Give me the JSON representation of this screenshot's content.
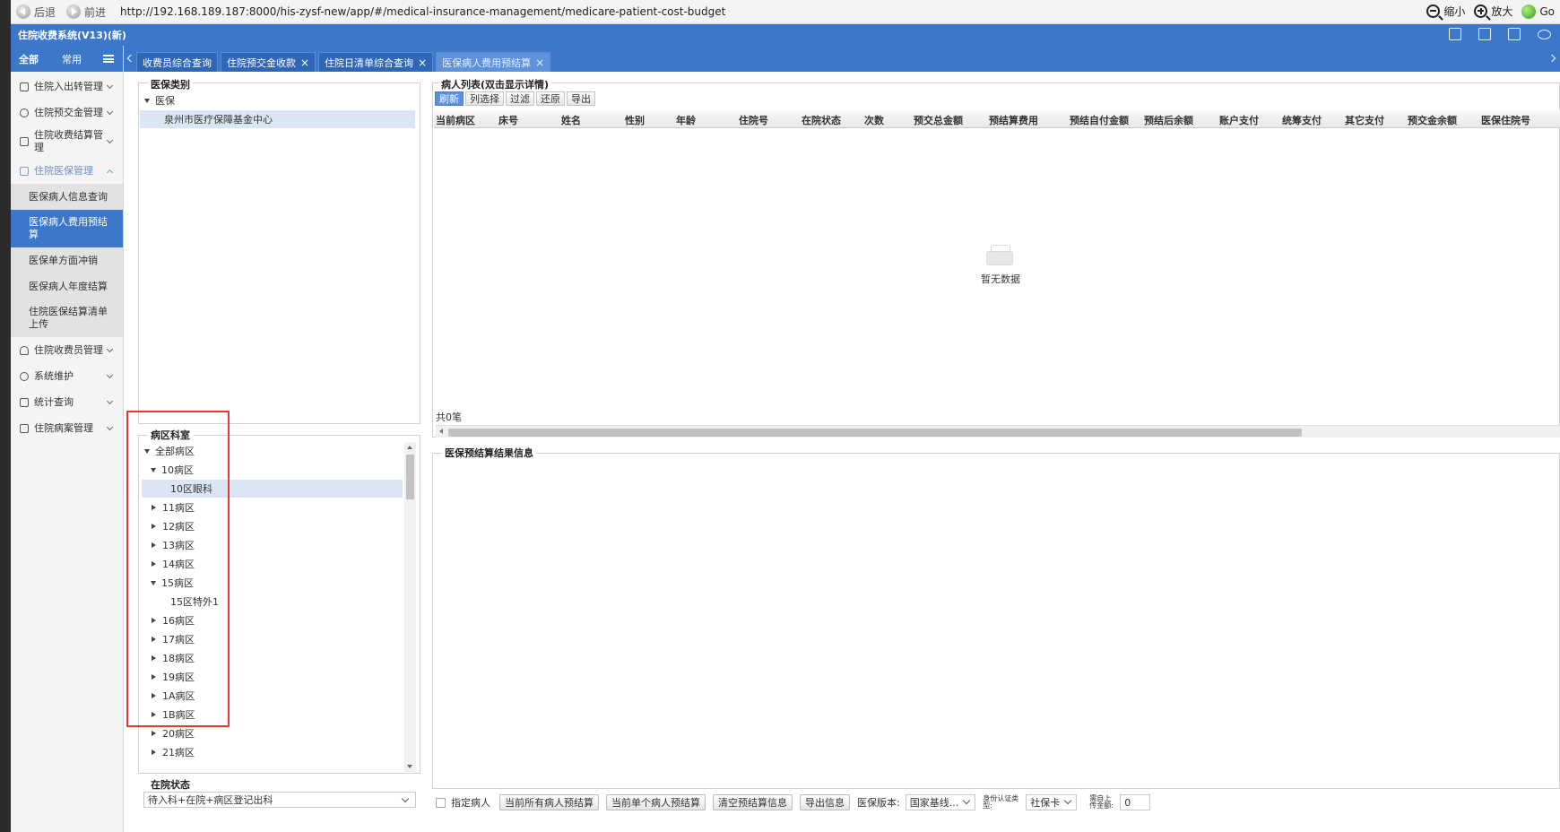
{
  "browser": {
    "back": "后退",
    "forward": "前进",
    "url": "http://192.168.189.187:8000/his-zysf-new/app/#/medical-insurance-management/medicare-patient-cost-budget",
    "zoom_out": "缩小",
    "zoom_in": "放大",
    "go": "Go"
  },
  "app": {
    "title": "住院收费系统(V13)(新)"
  },
  "sidebar": {
    "tabs": [
      "全部",
      "常用"
    ],
    "items": [
      {
        "label": "住院入出转管理"
      },
      {
        "label": "住院预交金管理"
      },
      {
        "label": "住院收费结算管理"
      },
      {
        "label": "住院医保管理"
      },
      {
        "label": "住院收费员管理"
      },
      {
        "label": "系统维护"
      },
      {
        "label": "统计查询"
      },
      {
        "label": "住院病案管理"
      }
    ],
    "subitems": [
      {
        "label": "医保病人信息查询"
      },
      {
        "label": "医保病人费用预结算"
      },
      {
        "label": "医保单方面冲销"
      },
      {
        "label": "医保病人年度结算"
      },
      {
        "label": "住院医保结算清单上传"
      }
    ]
  },
  "tabs": [
    {
      "label": "收费员综合查询"
    },
    {
      "label": "住院预交金收款"
    },
    {
      "label": "住院日清单综合查询"
    },
    {
      "label": "医保病人费用预结算"
    }
  ],
  "insurance_panel": {
    "title": "医保类别",
    "root": "医保",
    "child": "泉州市医疗保障基金中心"
  },
  "ward_panel": {
    "title": "病区科室",
    "root": "全部病区",
    "nodes": [
      {
        "label": "10病区"
      },
      {
        "label": "10区眼科"
      },
      {
        "label": "11病区"
      },
      {
        "label": "12病区"
      },
      {
        "label": "13病区"
      },
      {
        "label": "14病区"
      },
      {
        "label": "15病区"
      },
      {
        "label": "15区特外1"
      },
      {
        "label": "16病区"
      },
      {
        "label": "17病区"
      },
      {
        "label": "18病区"
      },
      {
        "label": "19病区"
      },
      {
        "label": "1A病区"
      },
      {
        "label": "1B病区"
      },
      {
        "label": "20病区"
      },
      {
        "label": "21病区"
      }
    ]
  },
  "status_panel": {
    "title": "在院状态",
    "selected": "待入科+在院+病区登记出科"
  },
  "patient_list": {
    "title": "病人列表(双击显示详情)",
    "toolbar": [
      "刷新",
      "列选择",
      "过滤",
      "还原",
      "导出"
    ],
    "columns": [
      "当前病区",
      "床号",
      "姓名",
      "性别",
      "年龄",
      "住院号",
      "在院状态",
      "次数",
      "预交总金额",
      "预结算费用",
      "预结自付金额",
      "预结后余额",
      "账户支付",
      "统筹支付",
      "其它支付",
      "预交金余额",
      "医保住院号"
    ],
    "empty_text": "暂无数据",
    "count_text": "共0笔"
  },
  "result_panel": {
    "title": "医保预结算结果信息"
  },
  "footer": {
    "checkbox_label": "指定病人",
    "btn_all": "当前所有病人预结算",
    "btn_single": "当前单个病人预结算",
    "btn_clear": "清空预结算信息",
    "btn_export": "导出信息",
    "version_label": "医保版本:",
    "version_value": "国家基线...",
    "idauth_label": "身份认证类型:",
    "idauth_value": "社保卡",
    "cap_label": "需自上传金额:",
    "cap_value": "0"
  }
}
